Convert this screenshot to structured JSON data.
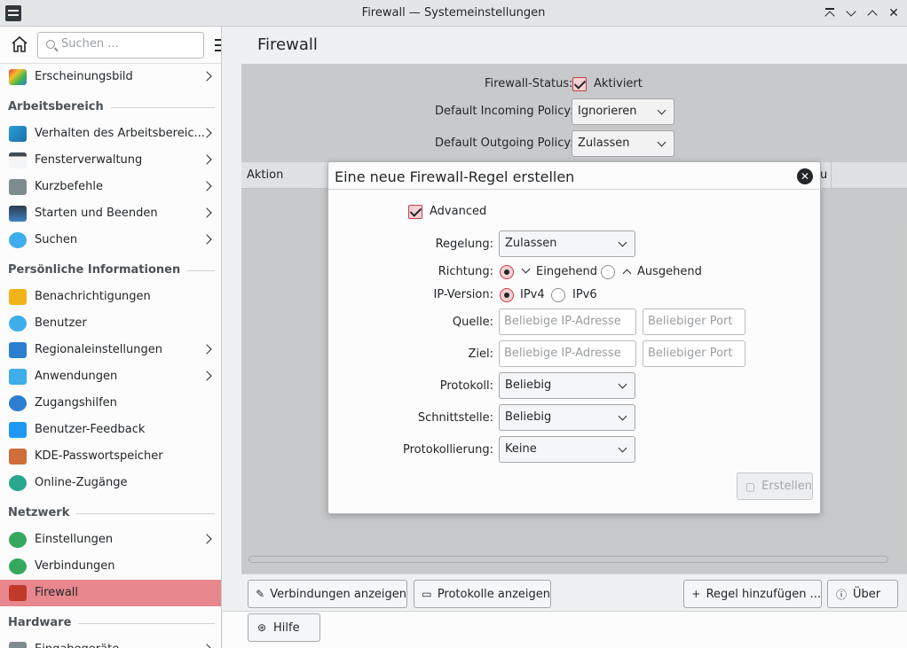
{
  "window": {
    "title": "Firewall — Systemeinstellungen",
    "buttons": {
      "keep_above": "⌃",
      "minimize": "⌄",
      "maximize": "⌃",
      "close": "✕"
    }
  },
  "sidebar": {
    "search_placeholder": "Suchen ...",
    "items": [
      {
        "label": "Erscheinungsbild",
        "icon": "appearance-icon",
        "arrow": true
      },
      {
        "category": "Arbeitsbereich"
      },
      {
        "label": "Verhalten des Arbeitsbereic...",
        "icon": "workspace-behavior-icon",
        "arrow": true
      },
      {
        "label": "Fensterverwaltung",
        "icon": "window-icon",
        "arrow": true
      },
      {
        "label": "Kurzbefehle",
        "icon": "keyboard-icon",
        "arrow": true
      },
      {
        "label": "Starten und Beenden",
        "icon": "startup-icon",
        "arrow": true
      },
      {
        "label": "Suchen",
        "icon": "search-icon",
        "arrow": true
      },
      {
        "category": "Persönliche Informationen"
      },
      {
        "label": "Benachrichtigungen",
        "icon": "bell-icon",
        "arrow": false
      },
      {
        "label": "Benutzer",
        "icon": "user-icon",
        "arrow": false
      },
      {
        "label": "Regionaleinstellungen",
        "icon": "region-icon",
        "arrow": true
      },
      {
        "label": "Anwendungen",
        "icon": "apps-icon",
        "arrow": true
      },
      {
        "label": "Zugangshilfen",
        "icon": "accessibility-icon",
        "arrow": false
      },
      {
        "label": "Benutzer-Feedback",
        "icon": "feedback-icon",
        "arrow": false
      },
      {
        "label": "KDE-Passwortspeicher",
        "icon": "wallet-icon",
        "arrow": false
      },
      {
        "label": "Online-Zugänge",
        "icon": "online-accounts-icon",
        "arrow": false
      },
      {
        "category": "Netzwerk"
      },
      {
        "label": "Einstellungen",
        "icon": "globe-icon",
        "arrow": true
      },
      {
        "label": "Verbindungen",
        "icon": "globe-icon",
        "arrow": false
      },
      {
        "label": "Firewall",
        "icon": "firewall-icon",
        "arrow": false,
        "active": true
      },
      {
        "category": "Hardware"
      },
      {
        "label": "Eingabegeräte",
        "icon": "input-icon",
        "arrow": true
      }
    ]
  },
  "main": {
    "title": "Firewall",
    "status_label": "Firewall-Status:",
    "status_value": "Aktiviert",
    "incoming_label": "Default Incoming Policy:",
    "incoming_value": "Ignorieren",
    "outgoing_label": "Default Outgoing Policy:",
    "outgoing_value": "Zulassen",
    "table_header_action": "Aktion",
    "table_header_partial": "u",
    "buttons": {
      "connections": "Verbindungen anzeigen",
      "logs": "Protokolle anzeigen",
      "add_rule": "Regel hinzufügen ...",
      "about": "Über",
      "help": "Hilfe"
    }
  },
  "dialog": {
    "title": "Eine neue Firewall-Regel erstellen",
    "advanced_label": "Advanced",
    "policy_label": "Regelung:",
    "policy_value": "Zulassen",
    "direction_label": "Richtung:",
    "direction_in": "Eingehend",
    "direction_out": "Ausgehend",
    "ipversion_label": "IP-Version:",
    "ipv4": "IPv4",
    "ipv6": "IPv6",
    "source_label": "Quelle:",
    "dest_label": "Ziel:",
    "ip_placeholder": "Beliebige IP-Adresse",
    "port_placeholder": "Beliebiger Port",
    "protocol_label": "Protokoll:",
    "protocol_value": "Beliebig",
    "interface_label": "Schnittstelle:",
    "interface_value": "Beliebig",
    "logging_label": "Protokollierung:",
    "logging_value": "Keine",
    "create_button": "Erstellen"
  }
}
